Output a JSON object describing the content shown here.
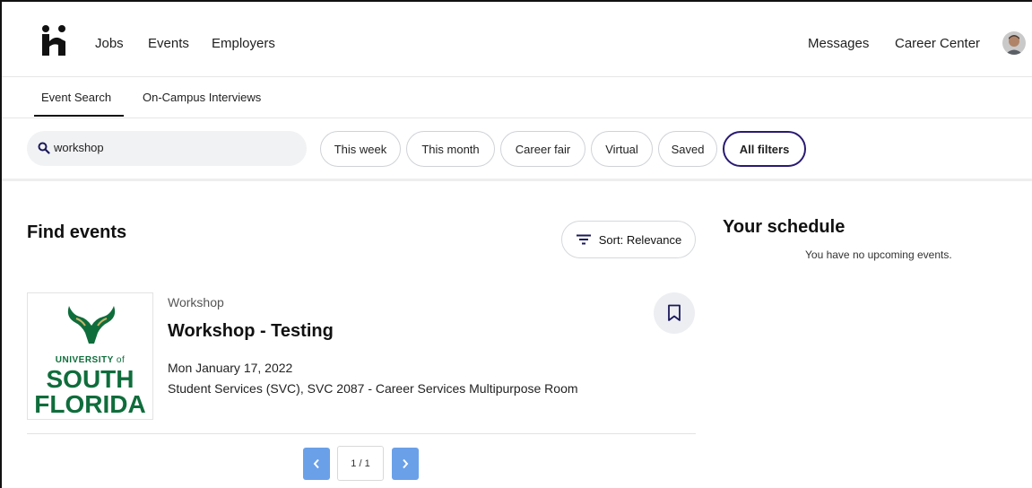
{
  "nav": {
    "left_links": [
      "Jobs",
      "Events",
      "Employers"
    ],
    "right_links": [
      "Messages",
      "Career Center"
    ]
  },
  "subtabs": [
    "Event Search",
    "On-Campus Interviews"
  ],
  "filters": {
    "search_value": "workshop",
    "chips": [
      "This week",
      "This month",
      "Career fair",
      "Virtual",
      "Saved",
      "All filters"
    ]
  },
  "events": {
    "title": "Find events",
    "sort_label": "Sort: Relevance",
    "items": [
      {
        "category": "Workshop",
        "title": "Workshop - Testing",
        "date": "Mon January 17, 2022",
        "location": "Student Services (SVC), SVC 2087 - Career Services Multipurpose Room",
        "org_logo": {
          "line1": "UNIVERSITY",
          "line1_suffix": "of",
          "line2": "SOUTH",
          "line3": "FLORIDA"
        }
      }
    ],
    "pagination": "1 / 1"
  },
  "schedule": {
    "title": "Your schedule",
    "empty_text": "You have no upcoming events."
  },
  "colors": {
    "accent": "#2a1a72",
    "usf_green": "#0f6d3b",
    "usf_gold": "#c8b46a",
    "pager_blue": "#6aa0e8"
  },
  "icons": [
    "handshake-logo-icon",
    "search-icon",
    "sort-icon",
    "bookmark-icon",
    "chevron-left-icon",
    "chevron-right-icon"
  ]
}
